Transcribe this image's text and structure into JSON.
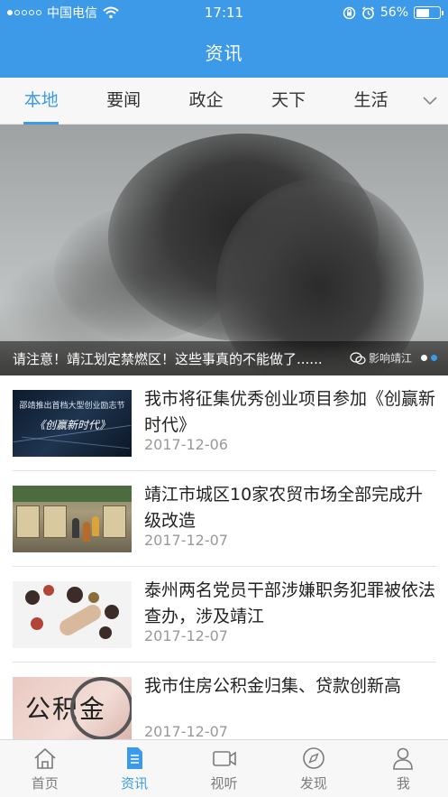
{
  "status_bar": {
    "carrier": "中国电信",
    "time": "17:11",
    "battery": "56%",
    "battery_level": 0.56,
    "icons": [
      "signal-dots-icon",
      "wifi-icon",
      "orientation-lock-icon",
      "alarm-icon",
      "battery-icon"
    ]
  },
  "header": {
    "title": "资讯"
  },
  "tabs": [
    {
      "label": "本地",
      "active": true
    },
    {
      "label": "要闻",
      "active": false
    },
    {
      "label": "政企",
      "active": false
    },
    {
      "label": "天下",
      "active": false
    },
    {
      "label": "生活",
      "active": false
    }
  ],
  "tabs_more_icon": "chevron-down-icon",
  "banner": {
    "caption": "请注意！靖江划定禁燃区！这些事真的不能做了......",
    "watermark": "影响靖江",
    "pages": 2,
    "active_page": 2
  },
  "news": [
    {
      "title": "我市将征集优秀创业项目参加《创赢新时代》",
      "date": "2017-12-06",
      "thumb_text_1": "邵靖推出首档大型创业励志节",
      "thumb_text_2": "《创赢新时代》"
    },
    {
      "title": "靖江市城区10家农贸市场全部完成升级改造",
      "date": "2017-12-07"
    },
    {
      "title": "泰州两名党员干部涉嫌职务犯罪被依法查办，涉及靖江",
      "date": "2017-12-07"
    },
    {
      "title": "我市住房公积金归集、贷款创新高",
      "date": "2017-12-07",
      "thumb_text_1": "公积金"
    }
  ],
  "tabbar": [
    {
      "label": "首页",
      "icon": "home-icon",
      "active": false
    },
    {
      "label": "资讯",
      "icon": "news-document-icon",
      "active": true
    },
    {
      "label": "视听",
      "icon": "video-camera-icon",
      "active": false
    },
    {
      "label": "发现",
      "icon": "compass-icon",
      "active": false
    },
    {
      "label": "我",
      "icon": "user-icon",
      "active": false
    }
  ],
  "colors": {
    "accent": "#3d9ae8",
    "text": "#222222",
    "muted": "#999999"
  }
}
